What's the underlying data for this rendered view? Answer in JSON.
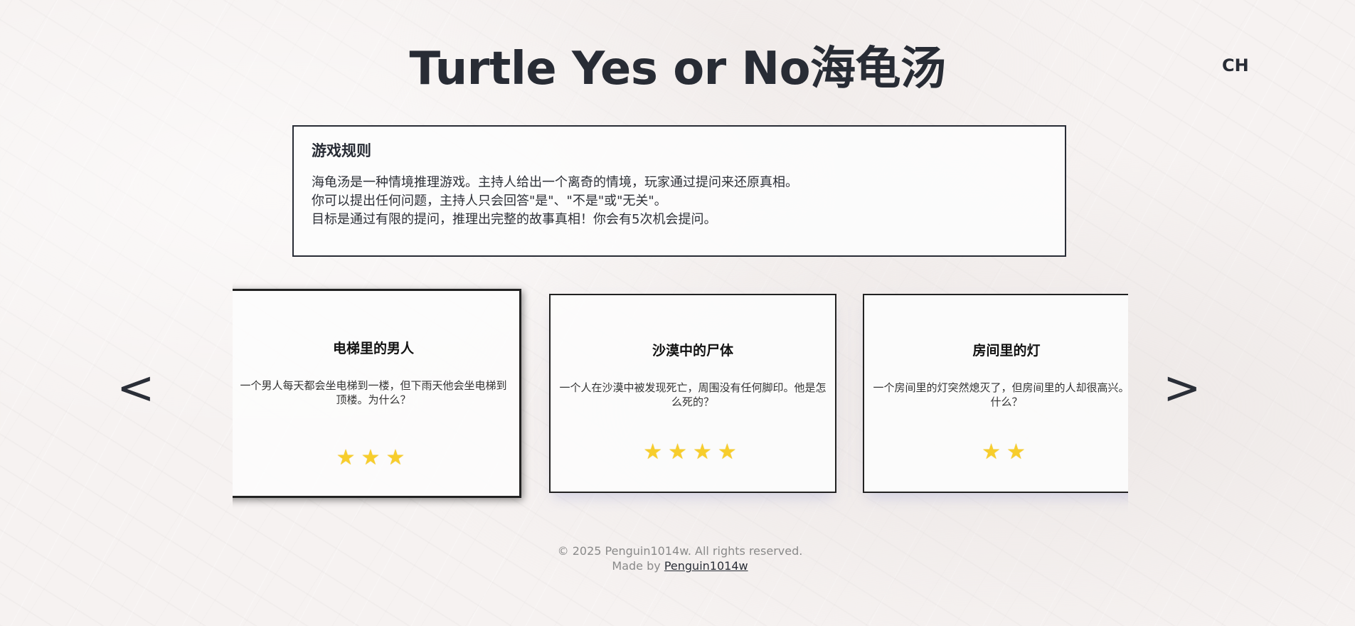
{
  "header": {
    "title": "Turtle Yes or No海龟汤",
    "language_toggle": "CH"
  },
  "rules": {
    "title": "游戏规则",
    "lines": [
      "海龟汤是一种情境推理游戏。主持人给出一个离奇的情境，玩家通过提问来还原真相。",
      "你可以提出任何问题，主持人只会回答\"是\"、\"不是\"或\"无关\"。",
      "目标是通过有限的提问，推理出完整的故事真相！你会有5次机会提问。"
    ]
  },
  "carousel": {
    "prev_label": "<",
    "next_label": ">",
    "cards": [
      {
        "title": "电梯里的男人",
        "description": "一个男人每天都会坐电梯到一楼，但下雨天他会坐电梯到顶楼。为什么？",
        "difficulty_stars": 3
      },
      {
        "title": "沙漠中的尸体",
        "description": "一个人在沙漠中被发现死亡，周围没有任何脚印。他是怎么死的？",
        "difficulty_stars": 4
      },
      {
        "title": "房间里的灯",
        "description": "一个房间里的灯突然熄灭了，但房间里的人却很高兴。为什么？",
        "difficulty_stars": 2
      }
    ]
  },
  "footer": {
    "copyright": "© 2025 Penguin1014w. All rights reserved.",
    "made_by_prefix": "Made by",
    "author_link": "Penguin1014w"
  },
  "colors": {
    "text": "#282c35",
    "star": "#f7cd2c",
    "border": "#222222",
    "footer_text": "#8a8a8a"
  }
}
